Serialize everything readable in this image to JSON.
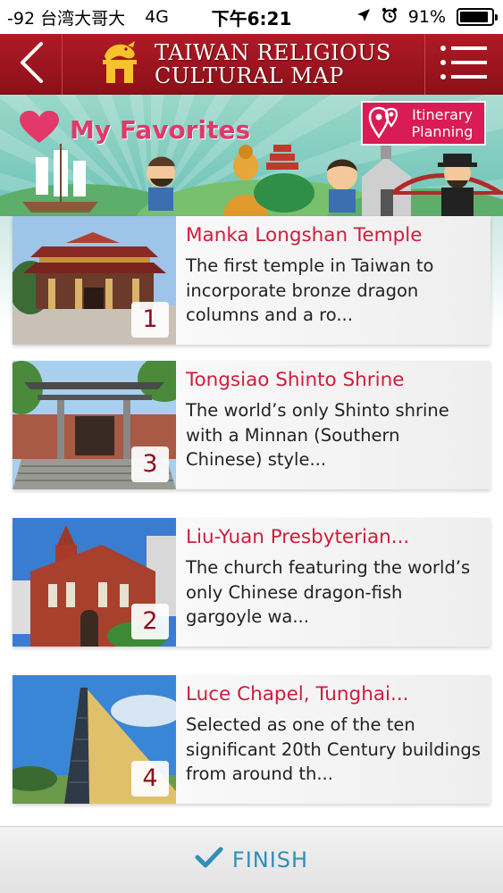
{
  "status_bar": {
    "carrier": "-92 台湾大哥大",
    "network": "4G",
    "time": "下午6:21",
    "battery": "91%",
    "battery_level": 0.91,
    "icons": [
      "location-arrow-icon",
      "alarm-icon",
      "battery-icon"
    ]
  },
  "header": {
    "title_line1": "Taiwan Religious",
    "title_line2": "Cultural Map",
    "back_icon": "chevron-left-icon",
    "menu_icon": "hamburger-menu-icon",
    "color": "#a0141d"
  },
  "banner": {
    "title": "My Favorites",
    "title_icon": "heart-icon",
    "itinerary_button": "Itinerary Planning",
    "itinerary_icon": "map-pins-icon",
    "accent": "#e2386a"
  },
  "favorites": [
    {
      "rank": "1",
      "title": "Manka Longshan Temple",
      "description": "The first temple in Taiwan to incorporate bronze dragon columns and a ro..."
    },
    {
      "rank": "3",
      "title": "Tongsiao Shinto Shrine",
      "description": "The world’s only Shinto shrine with a Minnan (Southern Chinese) style..."
    },
    {
      "rank": "2",
      "title": "Liu-Yuan Presbyterian...",
      "description": "The church featuring the world’s only Chinese dragon-fish gargoyle wa..."
    },
    {
      "rank": "4",
      "title": "Luce Chapel, Tunghai...",
      "description": "Selected as one of the ten significant 20th Century buildings from around th..."
    }
  ],
  "footer": {
    "finish_label": "FINISH",
    "finish_icon": "checkmark-icon",
    "color": "#2f8fb8"
  }
}
